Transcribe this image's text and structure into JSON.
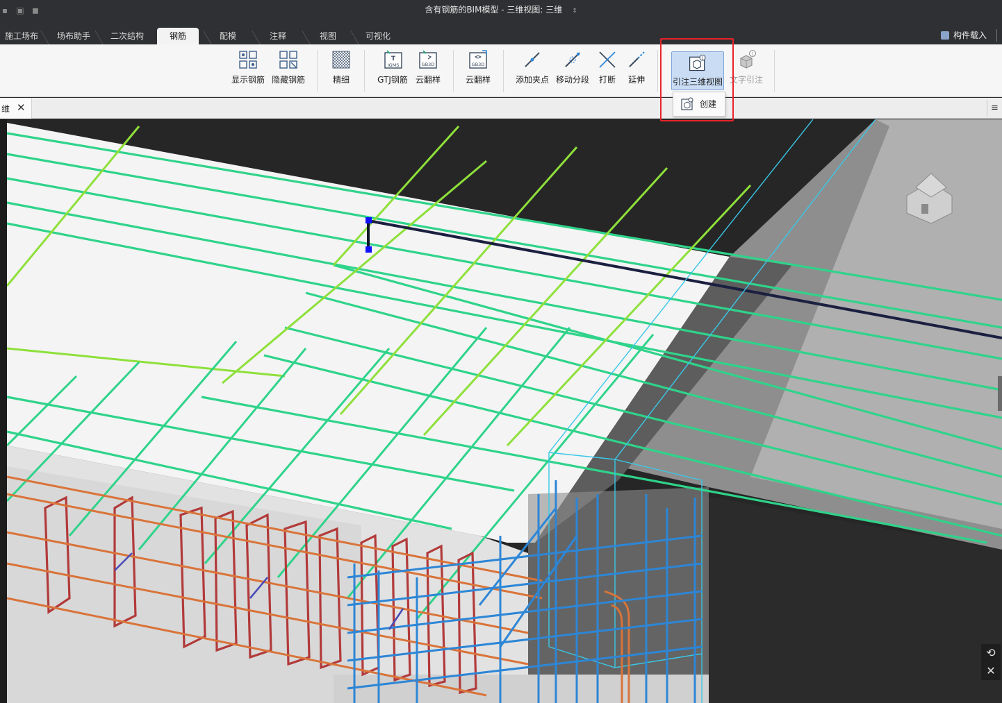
{
  "window": {
    "title": "含有钢筋的BIM模型 - 三维视图: 三维",
    "title_arrow": "⇕"
  },
  "menu_tabs": [
    {
      "label": "施工场布"
    },
    {
      "label": "场布助手"
    },
    {
      "label": "二次结构"
    },
    {
      "label": "钢筋",
      "active": true
    },
    {
      "label": "配模"
    },
    {
      "label": "注释"
    },
    {
      "label": "视图"
    },
    {
      "label": "可视化"
    }
  ],
  "load_button": {
    "label": "构件载入"
  },
  "ribbon": {
    "buttons": [
      {
        "label": "显示钢筋",
        "icon": "show-rebar-icon"
      },
      {
        "label": "隐藏钢筋",
        "icon": "hide-rebar-icon"
      },
      {
        "label": "精细",
        "icon": "fine-detail-icon"
      },
      {
        "label": "GTJ钢筋",
        "icon": "gtj-rebar-icon",
        "icon_text": "IGMS"
      },
      {
        "label": "云翻样",
        "icon": "cloud-layout-icon",
        "icon_text": "GB3D"
      },
      {
        "label": "云翻样",
        "icon": "cloud-layout-3d-icon",
        "icon_text": "GB3D"
      },
      {
        "label": "添加夹点",
        "icon": "add-grip-icon"
      },
      {
        "label": "移动分段",
        "icon": "move-segment-icon"
      },
      {
        "label": "打断",
        "icon": "break-icon"
      },
      {
        "label": "延伸",
        "icon": "extend-icon"
      },
      {
        "label": "引注三维视图",
        "icon": "annotate-3d-view-icon",
        "selected": true
      },
      {
        "label": "文字引注",
        "icon": "text-annotation-icon",
        "disabled": true
      }
    ],
    "dropdown": {
      "item_label": "创建",
      "icon": "create-icon"
    }
  },
  "doc_tab": {
    "label": "维",
    "close": "✕",
    "menu": "≡"
  },
  "viewport": {
    "controls": [
      {
        "name": "rotate-icon",
        "glyph": "⟲"
      },
      {
        "name": "close-icon",
        "glyph": "✕"
      }
    ]
  },
  "colors": {
    "green_rebar": "#2fd38a",
    "lime_rebar": "#8ee03a",
    "red_rebar": "#b23a3a",
    "orange_rebar": "#d9743a",
    "blue_rebar": "#2d86d6",
    "cyan_edge": "#39c8e8",
    "selection_blue": "#1010ff",
    "highlight_red": "#e8232b"
  }
}
